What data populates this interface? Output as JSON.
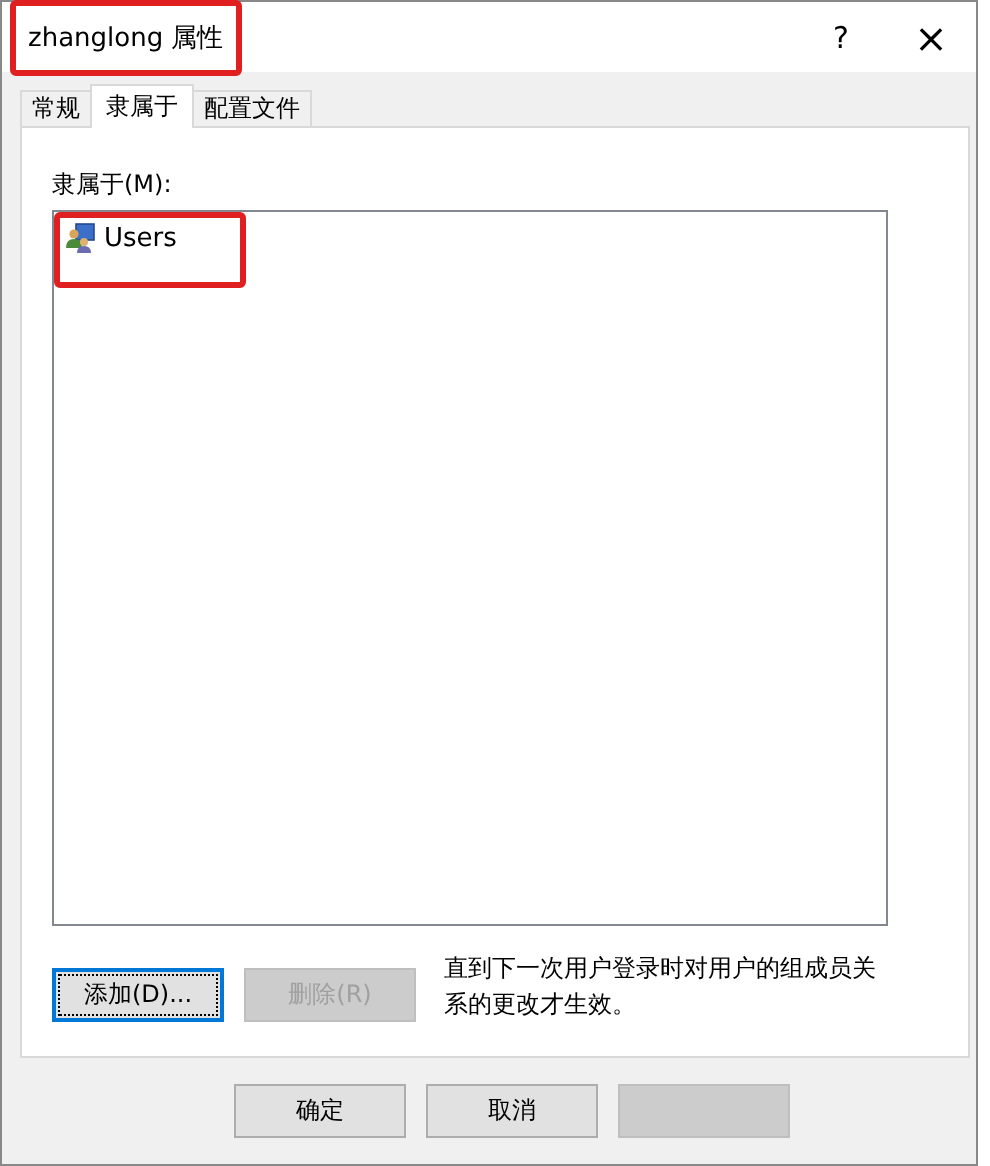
{
  "window": {
    "title": "zhanglong 属性",
    "title_highlighted": true,
    "help": "?",
    "close": "×"
  },
  "tabs": [
    {
      "label": "常规",
      "selected": false
    },
    {
      "label": "隶属于",
      "selected": true
    },
    {
      "label": "配置文件",
      "selected": false
    }
  ],
  "member_of": {
    "label": "隶属于(M):",
    "items": [
      {
        "name": "Users",
        "highlighted": true
      }
    ]
  },
  "actions": [
    {
      "label": "添加(D)...",
      "disabled": false,
      "focused": true
    },
    {
      "label": "删除(R)",
      "disabled": true,
      "focused": false
    }
  ],
  "note": "直到下一次用户登录时对用户的组成员关系的更改才生效。",
  "buttons": [
    {
      "label": "确定",
      "disabled": false
    },
    {
      "label": "取消",
      "disabled": false
    },
    {
      "disabled": true
    }
  ]
}
